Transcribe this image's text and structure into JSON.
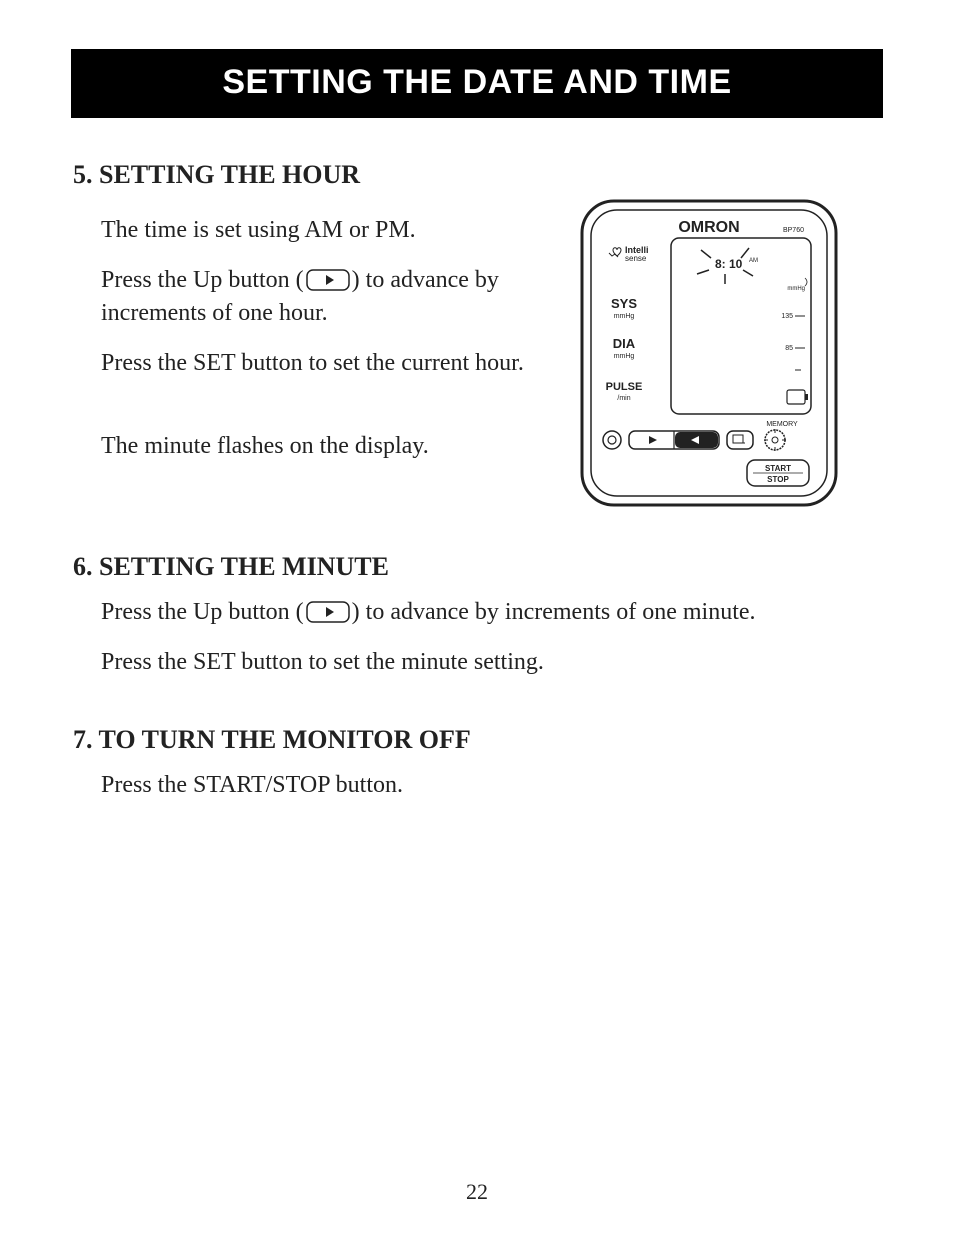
{
  "page_title": "SETTING THE DATE AND TIME",
  "page_number": "22",
  "sections": {
    "s5": {
      "heading": "5. SETTING THE HOUR",
      "p1": "The time is set using AM or PM.",
      "p2a": "Press the Up button (",
      "p2b": ") to advance by increments of one hour.",
      "p3": "Press the SET button to set the current hour.",
      "p4": "The minute flashes on the display."
    },
    "s6": {
      "heading": "6. SETTING THE MINUTE",
      "p1a": "Press the Up button (",
      "p1b": ") to advance by increments of one minute.",
      "p2": "Press the SET button to set the minute setting."
    },
    "s7": {
      "heading": "7. TO TURN THE MONITOR OFF",
      "p1": "Press the START/STOP button."
    }
  },
  "device": {
    "brand": "OMRON",
    "model": "BP760",
    "intelli": "Intelli\nsense",
    "display_time": "8: 10",
    "display_ampm": "AM",
    "labels": {
      "sys": "SYS",
      "sys_unit": "mmHg",
      "dia": "DIA",
      "dia_unit": "mmHg",
      "pulse": "PULSE",
      "pulse_unit": "/min",
      "mmhg": "mmHg",
      "tick135": "135",
      "tick85": "85",
      "memory": "MEMORY",
      "start": "START",
      "stop": "STOP"
    }
  }
}
